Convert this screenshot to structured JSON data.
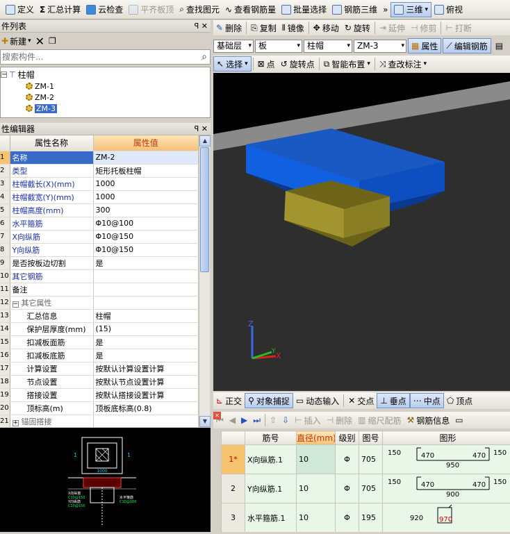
{
  "toolbar": {
    "items": [
      "定义",
      "汇总计算",
      "云检查",
      "平齐板顶",
      "查找图元",
      "查看钢筋量",
      "批量选择",
      "钢筋三维"
    ],
    "more": "»",
    "view3d": "三维",
    "view": "俯视"
  },
  "comp_list": {
    "title": "件列表",
    "pin": "ꟼ",
    "close": "✕",
    "new_label": "新建",
    "search_placeholder": "搜索构件...",
    "root": "柱帽",
    "items": [
      "ZM-1",
      "ZM-2",
      "ZM-3"
    ]
  },
  "prop_editor": {
    "title": "性编辑器",
    "col_name": "属性名称",
    "col_value": "属性值",
    "rows": [
      {
        "n": "1",
        "name": "名称",
        "value": "ZM-2"
      },
      {
        "n": "2",
        "name": "类型",
        "value": "矩形托板柱帽"
      },
      {
        "n": "3",
        "name": "柱帽截长(X)(mm)",
        "value": "1000"
      },
      {
        "n": "4",
        "name": "柱帽截宽(Y)(mm)",
        "value": "1000"
      },
      {
        "n": "5",
        "name": "柱帽高度(mm)",
        "value": "300"
      },
      {
        "n": "6",
        "name": "水平箍筋",
        "value": "Φ10@100"
      },
      {
        "n": "7",
        "name": "X向纵筋",
        "value": "Φ10@150"
      },
      {
        "n": "8",
        "name": "Y向纵筋",
        "value": "Φ10@150"
      },
      {
        "n": "9",
        "name": "是否按板边切割",
        "value": "是"
      },
      {
        "n": "10",
        "name": "其它钢筋",
        "value": ""
      },
      {
        "n": "11",
        "name": "备注",
        "value": ""
      },
      {
        "n": "12",
        "name": "其它属性",
        "value": ""
      },
      {
        "n": "13",
        "name": "汇总信息",
        "value": "柱帽"
      },
      {
        "n": "14",
        "name": "保护层厚度(mm)",
        "value": "(15)"
      },
      {
        "n": "15",
        "name": "扣减板面筋",
        "value": "是"
      },
      {
        "n": "16",
        "name": "扣减板底筋",
        "value": "是"
      },
      {
        "n": "17",
        "name": "计算设置",
        "value": "按默认计算设置计算"
      },
      {
        "n": "18",
        "name": "节点设置",
        "value": "按默认节点设置计算"
      },
      {
        "n": "19",
        "name": "搭接设置",
        "value": "按默认搭接设置计算"
      },
      {
        "n": "20",
        "name": "顶标高(m)",
        "value": "顶板底标高(0.8)"
      },
      {
        "n": "21",
        "name": "锚固搭接",
        "value": ""
      }
    ],
    "group_toggle": "−"
  },
  "preview": {
    "dim_label": "1000",
    "mark": "1",
    "labels": [
      "X向纵筋",
      "C10@150",
      "Y向纵筋",
      "C10@150",
      "水平箍筋",
      "C10@100"
    ]
  },
  "edit_toolbar": [
    "删除",
    "复制",
    "镜像",
    "移动",
    "旋转",
    "延伸",
    "修剪",
    "打断"
  ],
  "selectors": {
    "floor": "基础层",
    "category": "板",
    "type": "柱帽",
    "name": "ZM-3",
    "attr_button": "属性",
    "edit_rebar": "编辑钢筋"
  },
  "draw_toolbar": [
    "选择",
    "点",
    "旋转点",
    "智能布置",
    "查改标注"
  ],
  "snap_toolbar": [
    "正交",
    "对象捕捉",
    "动态输入",
    "交点",
    "垂点",
    "中点",
    "顶点"
  ],
  "axes": {
    "z": "Z",
    "x": "X",
    "y": "Y"
  },
  "rebar_toolbar": [
    "插入",
    "删除",
    "缩尺配筋",
    "钢筋信息"
  ],
  "rebar_table": {
    "headers": [
      "筋号",
      "直径(mm)",
      "级别",
      "图号",
      "图形"
    ],
    "rows": [
      {
        "n": "1*",
        "name": "X向纵筋.1",
        "dia": "10",
        "grade": "Φ",
        "code": "705",
        "shape": [
          "150",
          "470",
          "950",
          "470",
          "150"
        ]
      },
      {
        "n": "2",
        "name": "Y向纵筋.1",
        "dia": "10",
        "grade": "Φ",
        "code": "705",
        "shape": [
          "150",
          "470",
          "900",
          "470",
          "150"
        ]
      },
      {
        "n": "3",
        "name": "水平箍筋.1",
        "dia": "10",
        "grade": "Φ",
        "code": "195",
        "shape": [
          "920",
          "970"
        ]
      }
    ]
  },
  "colors": {
    "cap_blue": "#1560d0",
    "column_olive": "#a29530",
    "slab_gray": "#8a8a8a",
    "accent_orange": "#f6c07a",
    "selected_blue": "#3a6ac8"
  }
}
